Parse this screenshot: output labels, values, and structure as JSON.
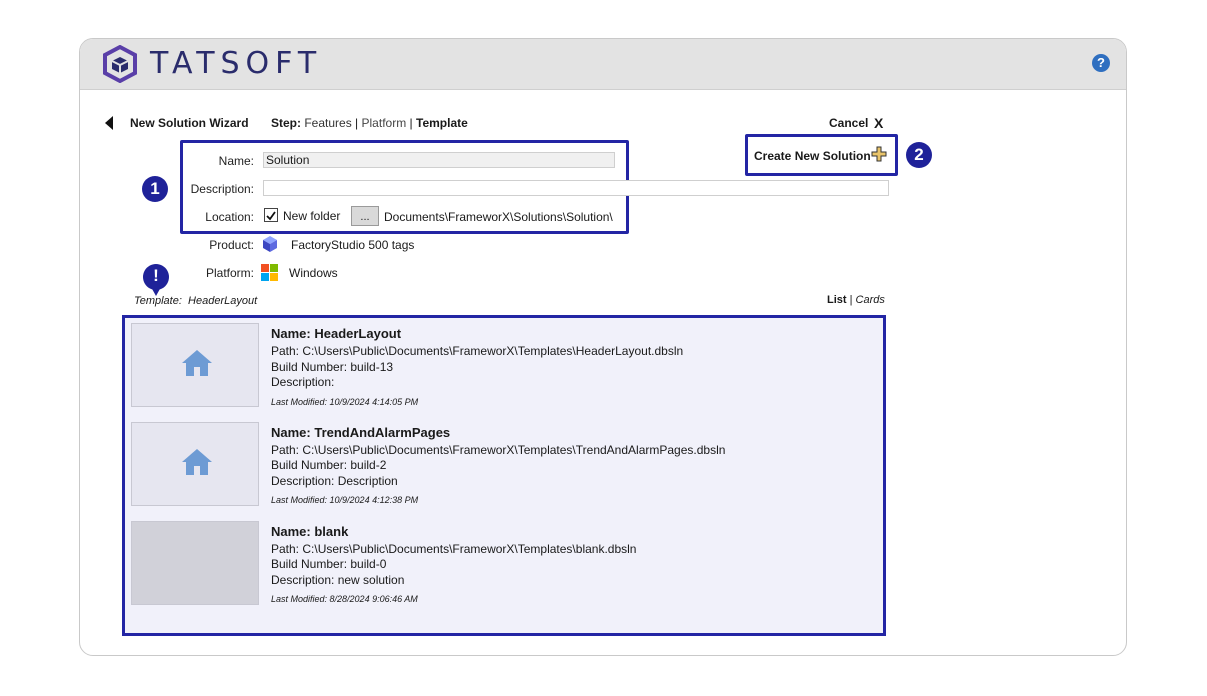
{
  "app": {
    "logo_text": "TATSOFT",
    "help_label": "?"
  },
  "wizard": {
    "title": "New Solution Wizard",
    "step_label": "Step:",
    "steps": [
      "Features",
      "Platform",
      "Template"
    ],
    "separator": "|",
    "cancel_label": "Cancel",
    "close_label": "X",
    "create_label": "Create New Solution"
  },
  "form": {
    "name_label": "Name:",
    "name_value": "Solution",
    "description_label": "Description:",
    "description_value": "",
    "location_label": "Location:",
    "new_folder_label": "New folder",
    "browse_label": "...",
    "location_value": "Documents\\FrameworX\\Solutions\\Solution\\",
    "product_label": "Product:",
    "product_value": "FactoryStudio 500 tags",
    "platform_label": "Platform:",
    "platform_value": "Windows"
  },
  "markers": {
    "one": "1",
    "two": "2",
    "warn": "!"
  },
  "template": {
    "label": "Template:",
    "value": "HeaderLayout",
    "view_list": "List",
    "view_cards": "Cards"
  },
  "templates": [
    {
      "name": "Name: HeaderLayout",
      "path": "Path:  C:\\Users\\Public\\Documents\\FrameworX\\Templates\\HeaderLayout.dbsln",
      "build": "Build Number:  build-13",
      "description": "Description:",
      "modified": "Last Modified:  10/9/2024 4:14:05 PM"
    },
    {
      "name": "Name: TrendAndAlarmPages",
      "path": "Path:  C:\\Users\\Public\\Documents\\FrameworX\\Templates\\TrendAndAlarmPages.dbsln",
      "build": "Build Number:  build-2",
      "description": "Description:  Description",
      "modified": "Last Modified:  10/9/2024 4:12:38 PM"
    },
    {
      "name": "Name: blank",
      "path": "Path:  C:\\Users\\Public\\Documents\\FrameworX\\Templates\\blank.dbsln",
      "build": "Build Number:  build-0",
      "description": "Description:  new solution",
      "modified": "Last Modified:  8/28/2024 9:06:46 AM"
    }
  ],
  "colors": {
    "accent": "#2325a4",
    "marker": "#1f2299",
    "logo": "#2a2c6c",
    "panel": "#f1f1fa",
    "home_icon": "#6d9bd4"
  }
}
